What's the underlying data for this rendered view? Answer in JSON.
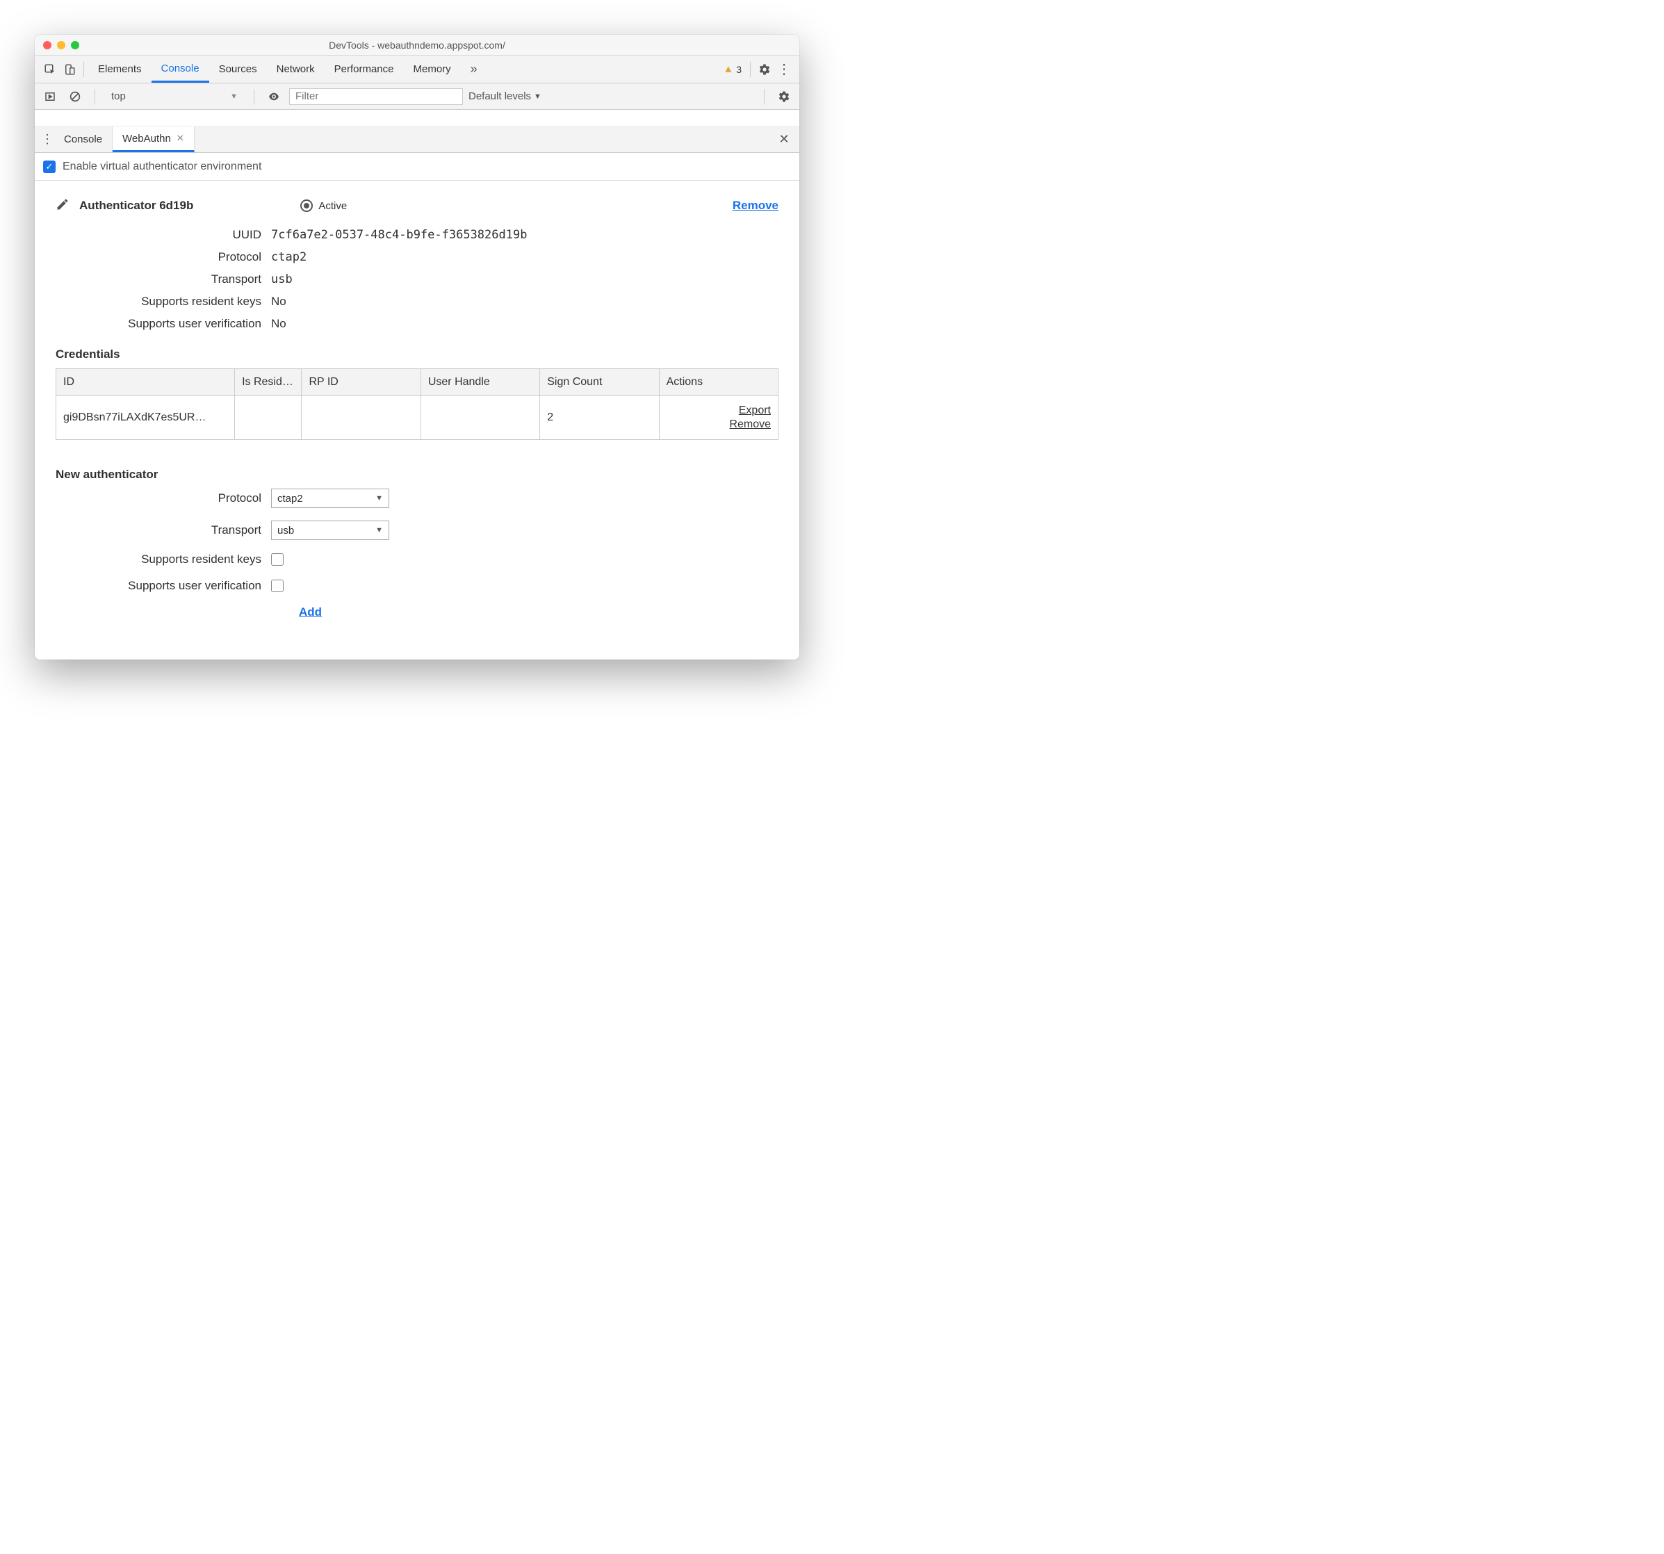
{
  "window": {
    "title": "DevTools - webauthndemo.appspot.com/"
  },
  "mainTabs": [
    "Elements",
    "Console",
    "Sources",
    "Network",
    "Performance",
    "Memory"
  ],
  "mainActive": "Console",
  "warnings": {
    "count": "3"
  },
  "consoleBar": {
    "context": "top",
    "filterPlaceholder": "Filter",
    "levels": "Default levels"
  },
  "drawerTabs": {
    "t0": "Console",
    "t1": "WebAuthn"
  },
  "enableLabel": "Enable virtual authenticator environment",
  "authenticator": {
    "title": "Authenticator 6d19b",
    "activeLabel": "Active",
    "removeLabel": "Remove",
    "fields": {
      "uuidLabel": "UUID",
      "uuid": "7cf6a7e2-0537-48c4-b9fe-f3653826d19b",
      "protocolLabel": "Protocol",
      "protocol": "ctap2",
      "transportLabel": "Transport",
      "transport": "usb",
      "srkLabel": "Supports resident keys",
      "srk": "No",
      "suvLabel": "Supports user verification",
      "suv": "No"
    }
  },
  "credentials": {
    "title": "Credentials",
    "headers": {
      "id": "ID",
      "isResident": "Is Resid…",
      "rp": "RP ID",
      "uh": "User Handle",
      "sc": "Sign Count",
      "actions": "Actions"
    },
    "row": {
      "id": "gi9DBsn77iLAXdK7es5UR…",
      "isResident": "",
      "rp": "",
      "uh": "",
      "sc": "2",
      "export": "Export",
      "remove": "Remove"
    }
  },
  "newAuth": {
    "title": "New authenticator",
    "protocolLabel": "Protocol",
    "protocol": "ctap2",
    "transportLabel": "Transport",
    "transport": "usb",
    "srkLabel": "Supports resident keys",
    "suvLabel": "Supports user verification",
    "addLabel": "Add"
  }
}
